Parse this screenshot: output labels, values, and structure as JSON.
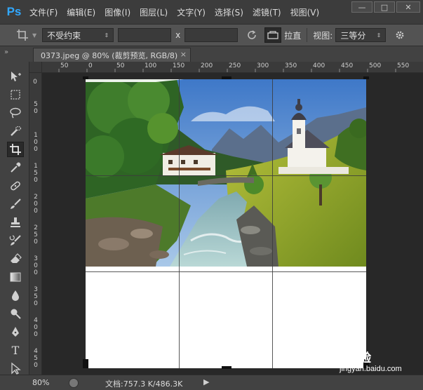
{
  "app": {
    "logo_text": "Ps"
  },
  "menu": {
    "items": [
      {
        "label": "文件(F)"
      },
      {
        "label": "编辑(E)"
      },
      {
        "label": "图像(I)"
      },
      {
        "label": "图层(L)"
      },
      {
        "label": "文字(Y)"
      },
      {
        "label": "选择(S)"
      },
      {
        "label": "滤镜(T)"
      },
      {
        "label": "视图(V)"
      }
    ]
  },
  "window_controls": {
    "minimize": "—",
    "maximize": "□",
    "close": "✕"
  },
  "options": {
    "ratio_value": "不受约束",
    "width_value": "",
    "height_value": "",
    "separator": "x",
    "straighten_label": "拉直",
    "view_label": "视图:",
    "view_value": "三等分"
  },
  "document": {
    "tab_title": "0373.jpeg @ 80% (裁剪预览, RGB/8)",
    "tab_close": "×"
  },
  "panel_toggle": "»",
  "ruler": {
    "top_labels": [
      "50",
      "0",
      "50",
      "100",
      "150",
      "200",
      "250",
      "300",
      "350",
      "400",
      "450",
      "500",
      "550"
    ],
    "left_labels": [
      "0",
      "5 0",
      "1 0 0",
      "1 5 0",
      "2 0 0",
      "2 5 0",
      "3 0 0",
      "3 5 0",
      "4 0 0",
      "4 5 0"
    ]
  },
  "status": {
    "zoom": "80%",
    "doc_info": "文档:757.3 K/486.3K",
    "arrow": "▶"
  },
  "watermark": {
    "logo_text": "Bai 经验",
    "url": "jingyan.baidu.com"
  },
  "colors": {
    "accent": "#31a8ff",
    "menubar": "#3c3c3c",
    "panel": "#535353",
    "canvas_bg": "#282828"
  }
}
